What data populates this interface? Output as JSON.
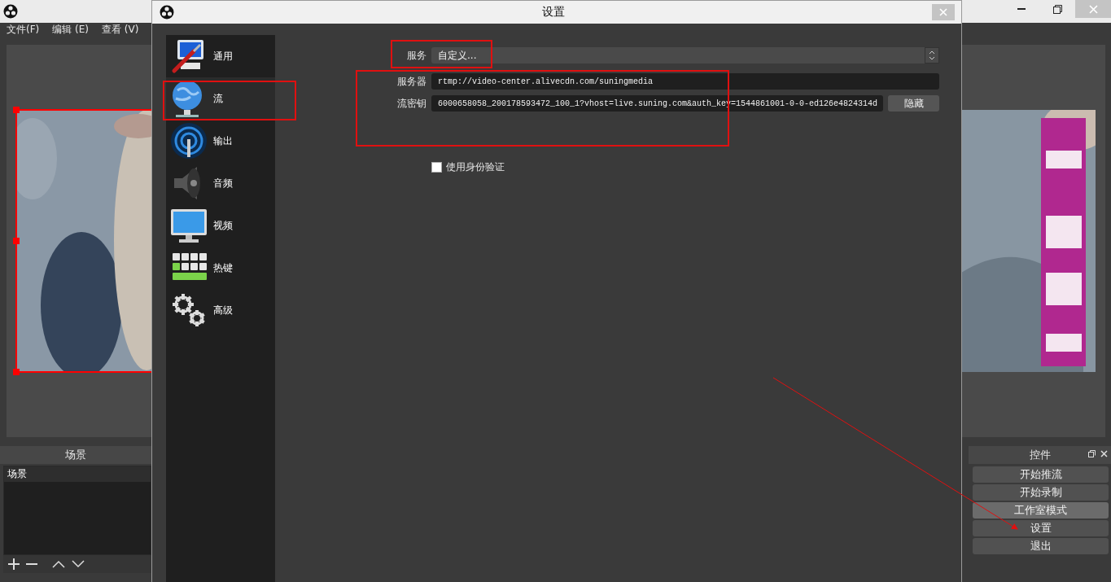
{
  "main_window": {
    "menu": [
      "文件(F)",
      "编辑 (E)",
      "查看 (V)"
    ]
  },
  "scenes_dock": {
    "title": "场景",
    "items": [
      {
        "label": "场景",
        "selected": true
      }
    ]
  },
  "controls_dock": {
    "title": "控件",
    "buttons": [
      {
        "label": "开始推流",
        "hovered": false
      },
      {
        "label": "开始录制",
        "hovered": false
      },
      {
        "label": "工作室模式",
        "hovered": true
      },
      {
        "label": "设置",
        "hovered": false
      },
      {
        "label": "退出",
        "hovered": false
      }
    ]
  },
  "settings_dialog": {
    "title": "设置",
    "sidebar": [
      {
        "kind": "general",
        "label": "通用",
        "selected": false
      },
      {
        "kind": "stream",
        "label": "流",
        "selected": true
      },
      {
        "kind": "output",
        "label": "输出",
        "selected": false
      },
      {
        "kind": "audio",
        "label": "音频",
        "selected": false
      },
      {
        "kind": "video",
        "label": "视频",
        "selected": false
      },
      {
        "kind": "hotkeys",
        "label": "热键",
        "selected": false
      },
      {
        "kind": "advanced",
        "label": "高级",
        "selected": false
      }
    ],
    "service": {
      "label": "服务",
      "value": "自定义..."
    },
    "server": {
      "label": "服务器",
      "value": "rtmp://video-center.alivecdn.com/suningmedia"
    },
    "stream_key": {
      "label": "流密钥",
      "value": "6000658058_200178593472_100_1?vhost=live.suning.com&auth_key=1544861001-0-0-ed126e4824314d",
      "button": "隐藏"
    },
    "auth": {
      "label": "使用身份验证",
      "checked": false
    }
  }
}
